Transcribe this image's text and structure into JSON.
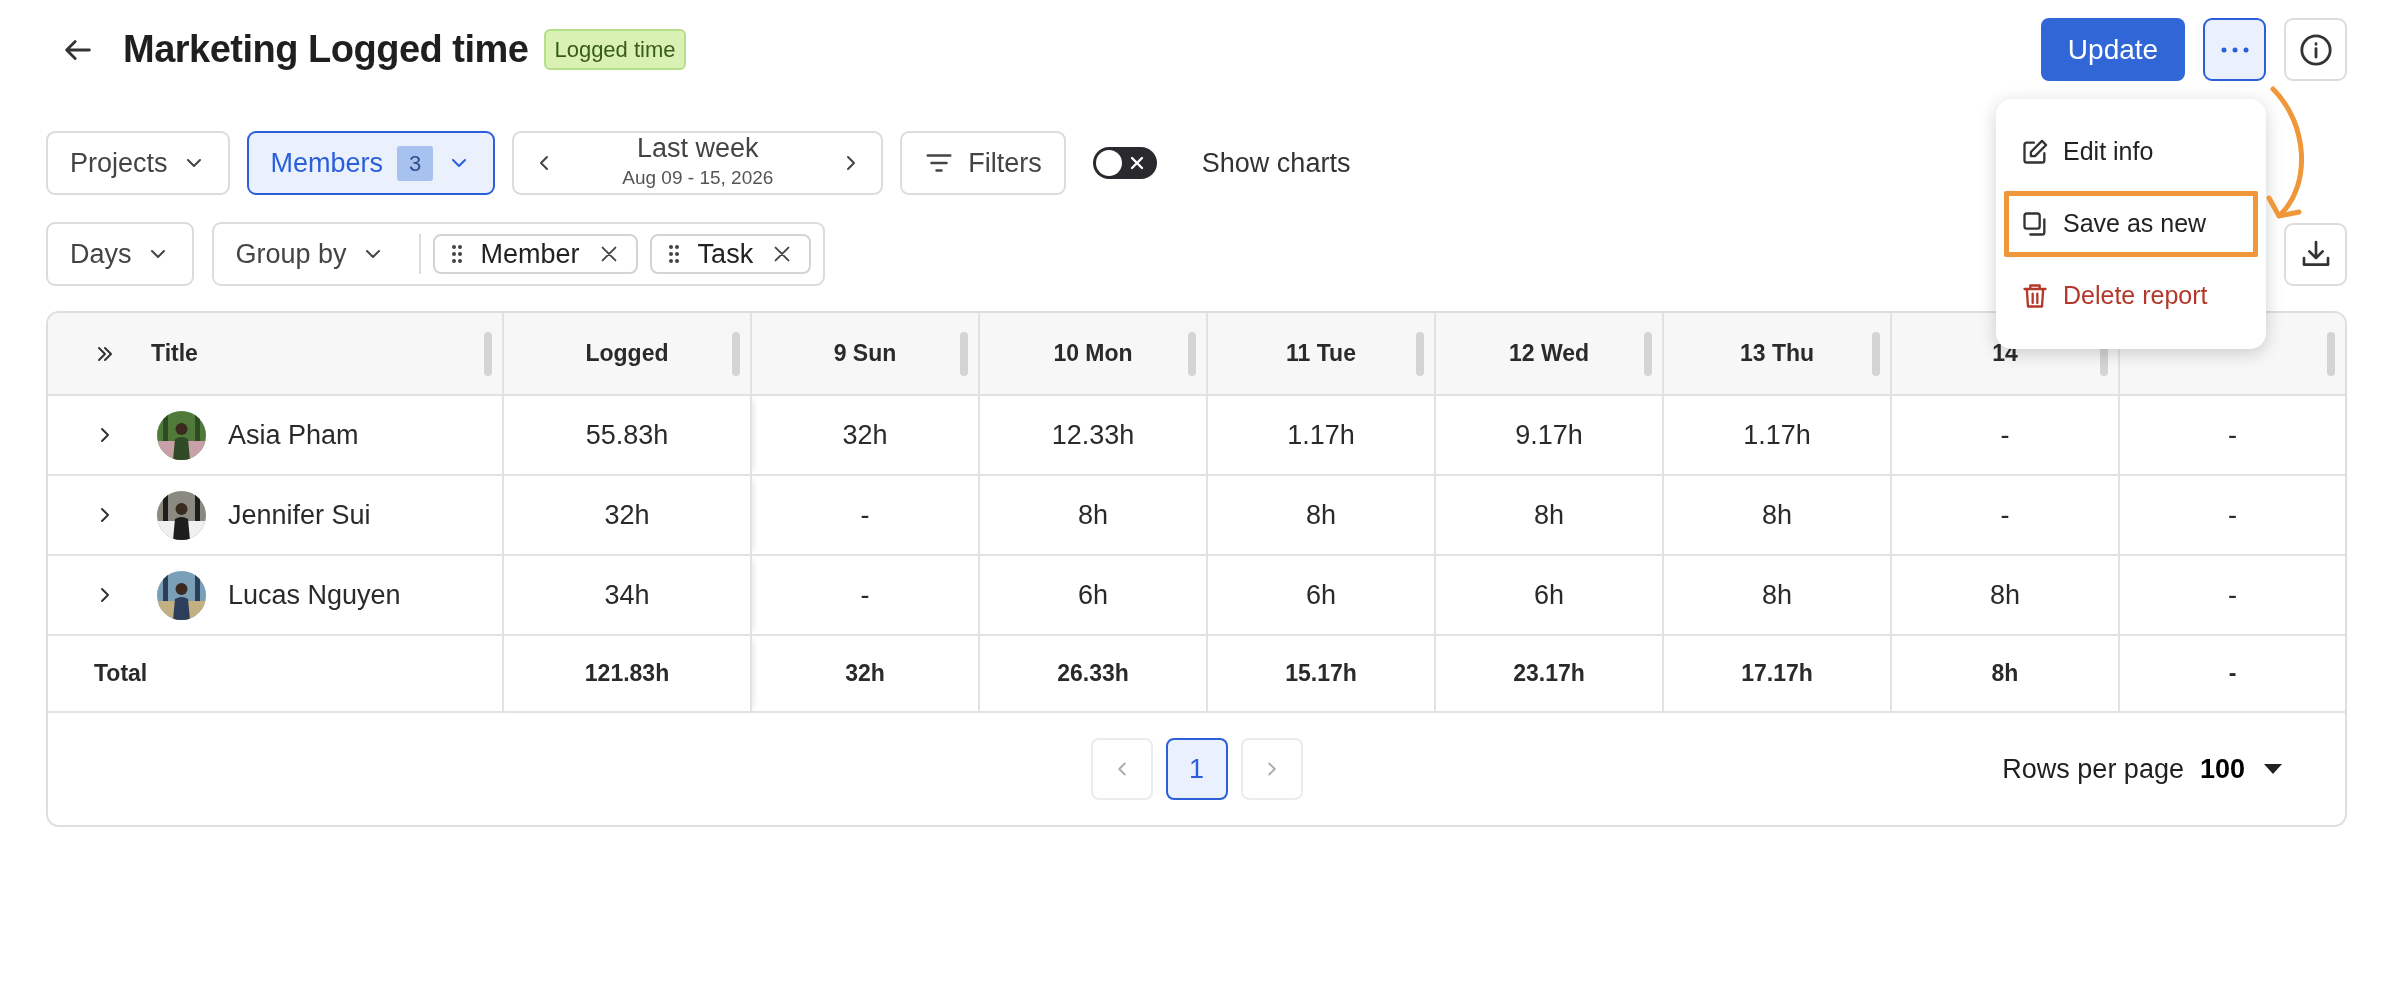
{
  "header": {
    "title": "Marketing Logged time",
    "tag": "Logged time"
  },
  "actions": {
    "update": "Update"
  },
  "menu": {
    "items": [
      {
        "kind": "edit",
        "label": "Edit info",
        "highlighted": false
      },
      {
        "kind": "copy",
        "label": "Save as new",
        "highlighted": true
      },
      {
        "kind": "delete",
        "label": "Delete report",
        "highlighted": false
      }
    ]
  },
  "filters": [
    {
      "kind": "dropdown",
      "label": "Projects",
      "selected": false
    },
    {
      "kind": "dropdown",
      "label": "Members",
      "count": "3",
      "selected": true
    },
    {
      "kind": "date",
      "label": "Last week",
      "sublabel": "Aug 09 - 15, 2026"
    },
    {
      "kind": "filter",
      "label": "Filters"
    },
    {
      "kind": "toggle",
      "label": "Show charts",
      "on": false
    }
  ],
  "grouping": {
    "period": "Days",
    "group_by": "Group by",
    "groups": [
      {
        "label": "Member"
      },
      {
        "label": "Task"
      }
    ]
  },
  "table": {
    "title_column": "Title",
    "columns": [
      "Logged",
      "9 Sun",
      "10 Mon",
      "11 Tue",
      "12 Wed",
      "13 Thu",
      "14"
    ],
    "rows": [
      {
        "name": "Asia Pham",
        "expanded": false,
        "cells": [
          "55.83h",
          "32h",
          "12.33h",
          "1.17h",
          "9.17h",
          "1.17h",
          "-",
          "-"
        ]
      },
      {
        "name": "Jennifer Sui",
        "expanded": false,
        "cells": [
          "32h",
          "-",
          "8h",
          "8h",
          "8h",
          "8h",
          "-",
          "-"
        ]
      },
      {
        "name": "Lucas Nguyen",
        "expanded": false,
        "cells": [
          "34h",
          "-",
          "6h",
          "6h",
          "6h",
          "8h",
          "8h",
          "-"
        ]
      }
    ],
    "total": {
      "label": "Total",
      "cells": [
        "121.83h",
        "32h",
        "26.33h",
        "15.17h",
        "23.17h",
        "17.17h",
        "8h",
        "-"
      ]
    }
  },
  "pagination": {
    "prev_disabled": true,
    "next_disabled": true,
    "pages": [
      {
        "label": "1",
        "selected": true
      }
    ],
    "rows_label": "Rows per page",
    "rows_value": "100"
  }
}
